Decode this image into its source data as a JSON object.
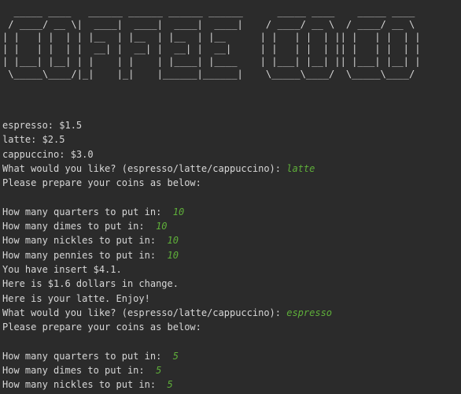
{
  "banner": "  _____ ____   ______ ______ ______ ______      _____ ____    _____ ____\n / ____/ __ \\|  ____|  ____|  ____|  ____|    / ____/ __ \\  / ____/ __ \\\n| |   | |  | | |__  | |__  | |__  | |__      | |   | |  | || |   | |  | |\n| |   | |  | |  __| |  __| |  __| |  __|     | |   | |  | || |   | |  | |\n| |___| |__| | |    | |    | |____| |____    | |___| |__| || |___| |__| |\n \\_____\\____/|_|    |_|    |______|______|    \\_____\\____/  \\_____\\____/",
  "colors": {
    "background": "#2b2b2b",
    "text": "#d7d7d7",
    "input": "#5faf3a"
  },
  "lines": [
    {
      "text": "espresso: $1.5",
      "input": ""
    },
    {
      "text": "latte: $2.5",
      "input": ""
    },
    {
      "text": "cappuccino: $3.0",
      "input": ""
    },
    {
      "text": "What would you like? (espresso/latte/cappuccino): ",
      "input": "latte"
    },
    {
      "text": "Please prepare your coins as below:",
      "input": ""
    },
    {
      "text": "",
      "input": ""
    },
    {
      "text": "How many quarters to put in:  ",
      "input": "10"
    },
    {
      "text": "How many dimes to put in:  ",
      "input": "10"
    },
    {
      "text": "How many nickles to put in:  ",
      "input": "10"
    },
    {
      "text": "How many pennies to put in:  ",
      "input": "10"
    },
    {
      "text": "You have insert $4.1.",
      "input": ""
    },
    {
      "text": "Here is $1.6 dollars in change.",
      "input": ""
    },
    {
      "text": "Here is your latte. Enjoy!",
      "input": ""
    },
    {
      "text": "What would you like? (espresso/latte/cappuccino): ",
      "input": "espresso"
    },
    {
      "text": "Please prepare your coins as below:",
      "input": ""
    },
    {
      "text": "",
      "input": ""
    },
    {
      "text": "How many quarters to put in:  ",
      "input": "5"
    },
    {
      "text": "How many dimes to put in:  ",
      "input": "5"
    },
    {
      "text": "How many nickles to put in:  ",
      "input": "5"
    }
  ]
}
